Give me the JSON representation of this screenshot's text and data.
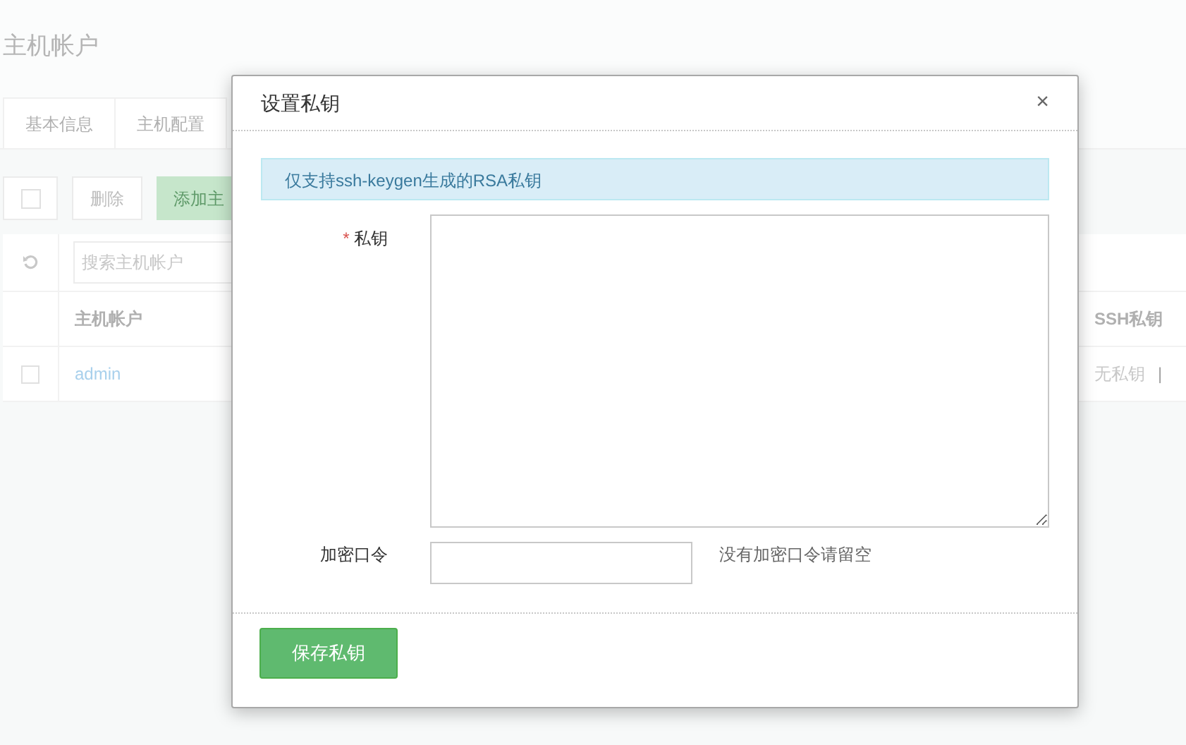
{
  "page_title": "主机帐户",
  "tabs": [
    {
      "label": "基本信息"
    },
    {
      "label": "主机配置"
    }
  ],
  "toolbar": {
    "select_all_checked": false,
    "delete_button": "删除",
    "add_button": "添加主"
  },
  "search": {
    "placeholder": "搜索主机帐户"
  },
  "table": {
    "columns": [
      "主机帐户",
      "SSH私钥"
    ],
    "rows": [
      {
        "checked": false,
        "account": "admin",
        "key_status": "无私钥",
        "separator": "|"
      }
    ]
  },
  "dialog": {
    "title": "设置私钥",
    "close": "×",
    "notice": "仅支持ssh-keygen生成的RSA私钥",
    "fields": [
      {
        "kind": "textarea",
        "required_mark": "*",
        "label": "私钥"
      },
      {
        "kind": "input",
        "label": "加密口令",
        "help": "没有加密口令请留空"
      }
    ],
    "save_button": "保存私钥"
  }
}
